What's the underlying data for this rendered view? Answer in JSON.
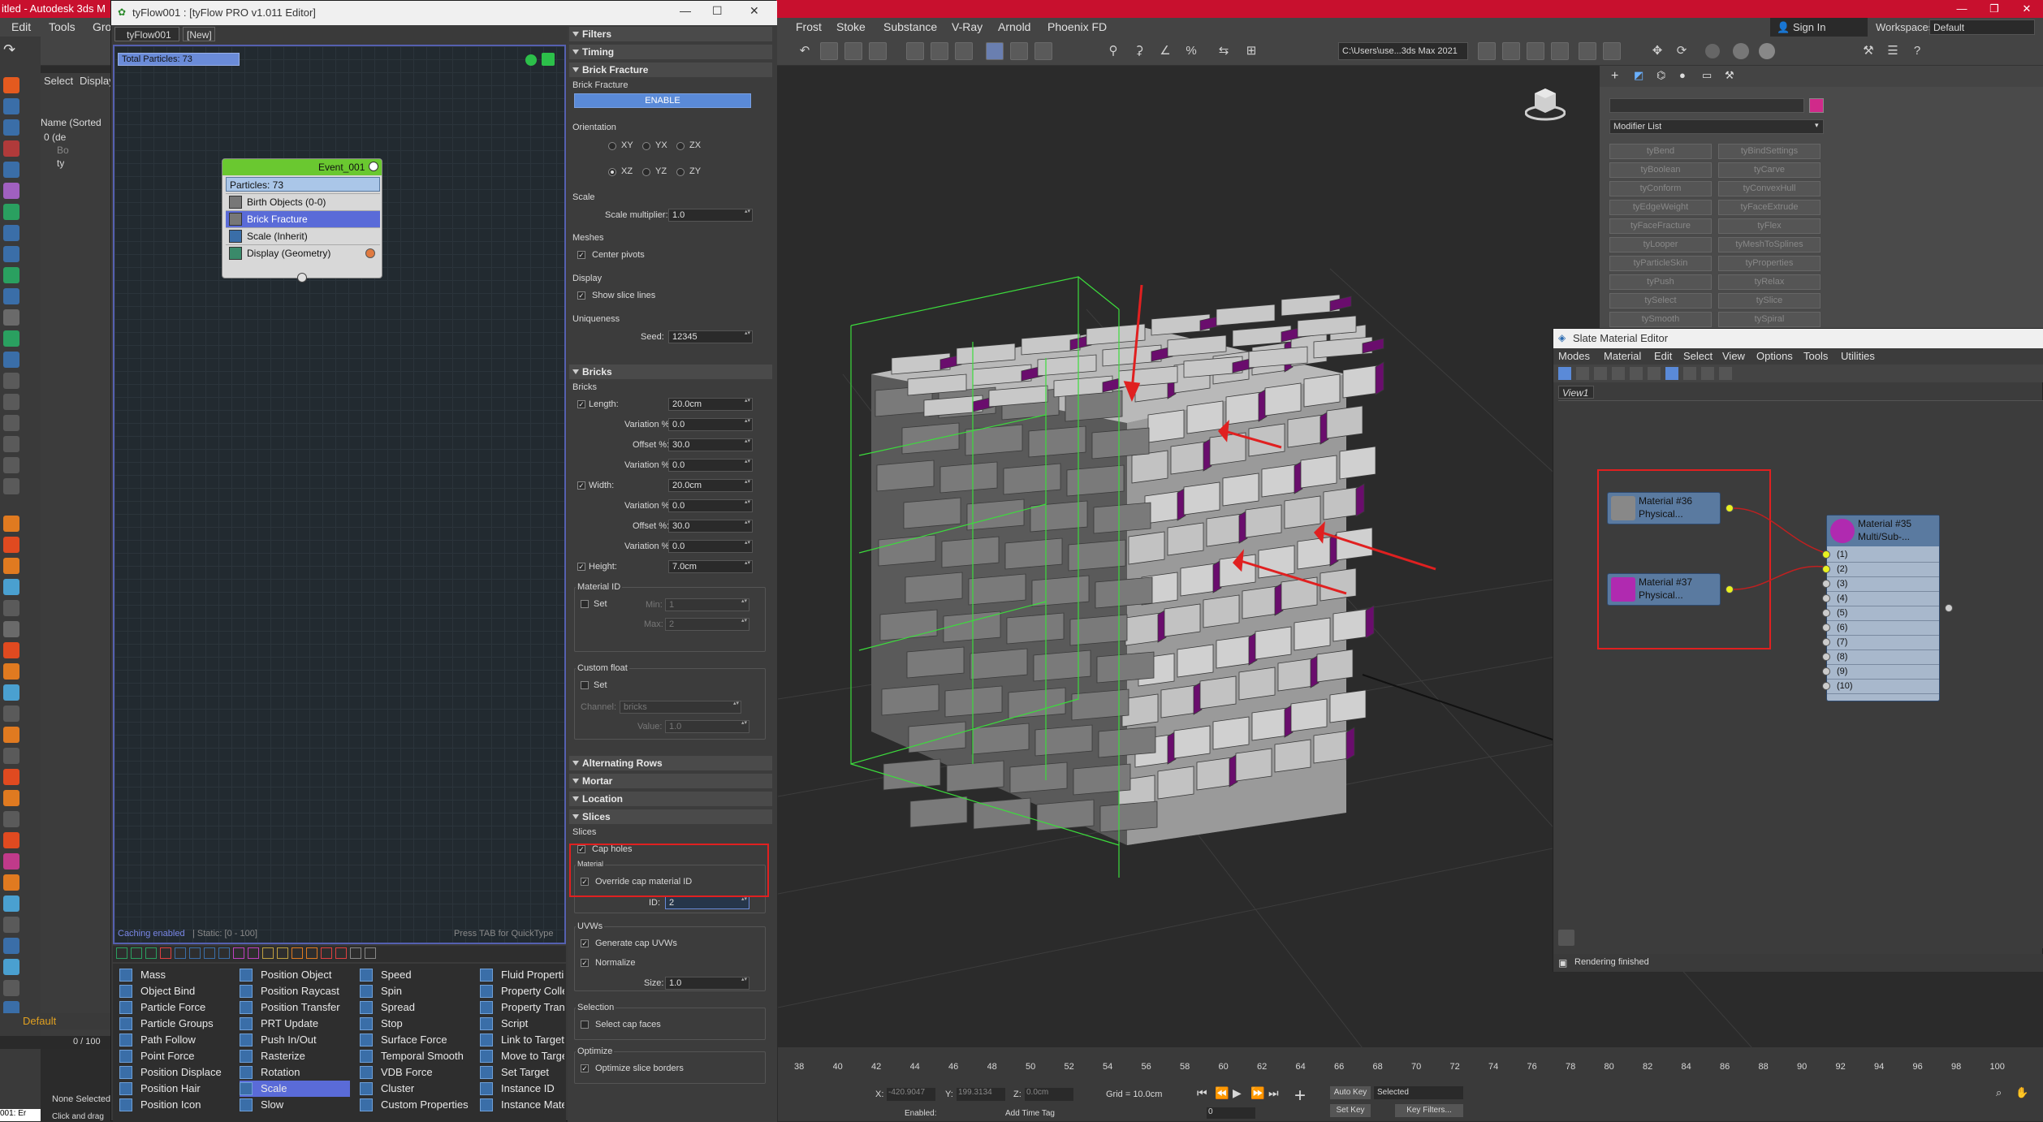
{
  "max": {
    "title": "itled - Autodesk 3ds M",
    "menu": [
      "Edit",
      "Tools",
      "Gro"
    ],
    "right_menu": [
      "Frost",
      "Stoke",
      "Substance",
      "V-Ray",
      "Arnold",
      "Phoenix FD"
    ],
    "signin": "Sign In",
    "workspaces_label": "Workspaces:",
    "workspace": "Default",
    "path": "C:\\Users\\use...3ds Max 2021",
    "select_label": "Select",
    "display_label": "Display",
    "scene_header": "Name (Sorted",
    "scene_items": [
      "0 (de",
      "Bo",
      "ty"
    ],
    "layer": "Default",
    "frame": "0 / 100",
    "none_selected": "None Selected",
    "click_drag": "Click and drag",
    "status_line": "001: Er"
  },
  "tyflow": {
    "title": "tyFlow001 : [tyFlow PRO v1.011 Editor]",
    "tabs": [
      "tyFlow001",
      "[New]"
    ],
    "total_particles": "Total Particles: 73",
    "event": {
      "name": "Event_001",
      "particles": "Particles: 73",
      "operators": [
        "Birth Objects (0-0)",
        "Brick Fracture",
        "Scale (Inherit)",
        "Display (Geometry)"
      ]
    },
    "caching": "Caching enabled",
    "static": "| Static: [0 - 100]",
    "quicktype": "Press TAB for QuickType",
    "operator_columns": [
      [
        "Mass",
        "Object Bind",
        "Particle Force",
        "Particle Groups",
        "Path Follow",
        "Point Force",
        "Position Displace",
        "Position Hair",
        "Position Icon"
      ],
      [
        "Position Object",
        "Position Raycast",
        "Position Transfer",
        "PRT Update",
        "Push In/Out",
        "Rasterize",
        "Rotation",
        "Scale",
        "Slow"
      ],
      [
        "Speed",
        "Spin",
        "Spread",
        "Stop",
        "Surface Force",
        "Temporal Smooth",
        "VDB Force",
        "Cluster",
        "Custom Properties"
      ],
      [
        "Fluid Properti",
        "Property Colle",
        "Property Trans",
        "Script",
        "Link to Target",
        "Move to Targe",
        "Set Target",
        "Instance ID",
        "Instance Mate"
      ]
    ]
  },
  "props": {
    "rollouts": {
      "filters": "Filters",
      "timing": "Timing",
      "brick_fracture": "Brick Fracture",
      "bricks": "Bricks",
      "alternating_rows": "Alternating Rows",
      "mortar": "Mortar",
      "location": "Location",
      "slices": "Slices"
    },
    "brick_fracture_label": "Brick Fracture",
    "enable": "ENABLE",
    "orientation": {
      "title": "Orientation",
      "opts": [
        "XY",
        "YX",
        "ZX",
        "XZ",
        "YZ",
        "ZY"
      ]
    },
    "scale": {
      "title": "Scale",
      "label": "Scale multiplier:",
      "value": "1.0"
    },
    "meshes": {
      "title": "Meshes",
      "center_pivots": "Center pivots"
    },
    "display": {
      "title": "Display",
      "show_slice": "Show slice lines"
    },
    "uniqueness": {
      "title": "Uniqueness",
      "seed_label": "Seed:",
      "seed": "12345"
    },
    "bricks_group": "Bricks",
    "length": {
      "label": "Length:",
      "value": "20.0cm"
    },
    "variation": "Variation %:",
    "offset": "Offset %:",
    "v1": "0.0",
    "off1": "30.0",
    "v2": "0.0",
    "width": {
      "label": "Width:",
      "value": "20.0cm"
    },
    "v3": "0.0",
    "off2": "30.0",
    "v4": "0.0",
    "height": {
      "label": "Height:",
      "value": "7.0cm"
    },
    "material_id": {
      "title": "Material ID",
      "set": "Set",
      "min_label": "Min:",
      "min": "1",
      "max_label": "Max:",
      "max": "2"
    },
    "custom_float": {
      "title": "Custom float",
      "set": "Set",
      "channel_label": "Channel:",
      "channel": "bricks",
      "value_label": "Value:",
      "value": "1.0"
    },
    "slices_group": "Slices",
    "cap_holes": "Cap holes",
    "material_cut": "Material",
    "override": "Override cap material ID",
    "id_label": "ID:",
    "id": "2",
    "uvws": {
      "title": "UVWs",
      "gen": "Generate cap UVWs",
      "norm": "Normalize",
      "size_label": "Size:",
      "size": "1.0"
    },
    "selection": {
      "title": "Selection",
      "cap": "Select cap faces"
    },
    "optimize": {
      "title": "Optimize",
      "borders": "Optimize slice borders"
    }
  },
  "cmd": {
    "modifier_list": "Modifier List",
    "mods": [
      [
        "tyBend",
        "tyBindSettings"
      ],
      [
        "tyBoolean",
        "tyCarve"
      ],
      [
        "tyConform",
        "tyConvexHull"
      ],
      [
        "tyEdgeWeight",
        "tyFaceExtrude"
      ],
      [
        "tyFaceFracture",
        "tyFlex"
      ],
      [
        "tyLooper",
        "tyMeshToSplines"
      ],
      [
        "tyParticleSkin",
        "tyProperties"
      ],
      [
        "tyPush",
        "tyRelax"
      ],
      [
        "tySelect",
        "tySlice"
      ],
      [
        "tySmooth",
        "tySpiral"
      ]
    ]
  },
  "slate": {
    "title": "Slate Material Editor",
    "menu": [
      "Modes",
      "Material",
      "Edit",
      "Select",
      "View",
      "Options",
      "Tools",
      "Utilities"
    ],
    "view_tab": "View1",
    "mat36": [
      "Material #36",
      "Physical..."
    ],
    "mat37": [
      "Material #37",
      "Physical..."
    ],
    "mat35": [
      "Material #35",
      "Multi/Sub-..."
    ],
    "slots": [
      "(1)",
      "(2)",
      "(3)",
      "(4)",
      "(5)",
      "(6)",
      "(7)",
      "(8)",
      "(9)",
      "(10)"
    ],
    "status": "Rendering finished"
  },
  "timeline": {
    "ticks": [
      "38",
      "40",
      "42",
      "44",
      "46",
      "48",
      "50",
      "52",
      "54",
      "56",
      "58",
      "60",
      "62",
      "64",
      "66",
      "68",
      "70",
      "72",
      "74",
      "76",
      "78",
      "80",
      "82",
      "84",
      "86",
      "88",
      "90",
      "92",
      "94",
      "96",
      "98",
      "100"
    ]
  },
  "status": {
    "x_label": "X:",
    "x": "-420.9047",
    "y_label": "Y:",
    "y": "199.3134",
    "z_label": "Z:",
    "z": "0.0cm",
    "grid": "Grid = 10.0cm",
    "auto_key": "Auto Key",
    "selected": "Selected",
    "set_key": "Set Key",
    "key_filters": "Key Filters...",
    "enabled": "Enabled:",
    "add_time_tag": "Add Time Tag",
    "frame_val": "0"
  },
  "colors": {
    "title_red": "#c8102e",
    "selection_blue": "#5a6bd8",
    "brick_gray": "#b9b9b9",
    "brick_purple": "#6a0d6d",
    "wire_green": "#3cdc3c",
    "annotation_red": "#e02020",
    "port_yellow": "#e8f020"
  }
}
